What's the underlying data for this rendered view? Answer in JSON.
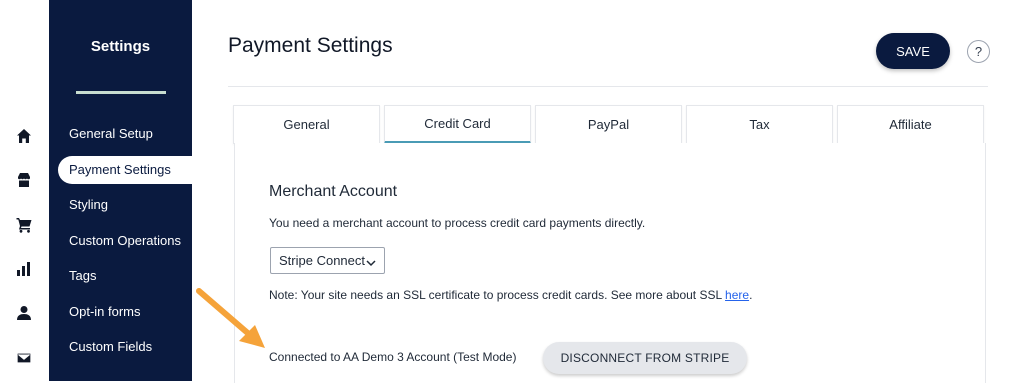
{
  "rail": {
    "icons": [
      "home-icon",
      "store-icon",
      "cart-icon",
      "chart-icon",
      "user-icon",
      "mail-icon"
    ]
  },
  "sidebar": {
    "title": "Settings",
    "items": [
      {
        "label": "General Setup",
        "active": false
      },
      {
        "label": "Payment Settings",
        "active": true
      },
      {
        "label": "Styling",
        "active": false
      },
      {
        "label": "Custom Operations",
        "active": false
      },
      {
        "label": "Tags",
        "active": false
      },
      {
        "label": "Opt-in forms",
        "active": false
      },
      {
        "label": "Custom Fields",
        "active": false
      }
    ]
  },
  "header": {
    "title": "Payment Settings",
    "save_label": "SAVE",
    "help_label": "?"
  },
  "tabs": [
    {
      "label": "General",
      "active": false
    },
    {
      "label": "Credit Card",
      "active": true
    },
    {
      "label": "PayPal",
      "active": false
    },
    {
      "label": "Tax",
      "active": false
    },
    {
      "label": "Affiliate",
      "active": false
    }
  ],
  "merchant": {
    "title": "Merchant Account",
    "description": "You need a merchant account to process credit card payments directly.",
    "select_value": "Stripe Connect",
    "note_prefix": "Note: Your site needs an SSL certificate to process credit cards. See more about SSL ",
    "note_link": "here",
    "note_suffix": ".",
    "connected_text": "Connected to AA Demo 3 Account (Test Mode)",
    "disconnect_label": "DISCONNECT FROM STRIPE"
  },
  "colors": {
    "sidebar_bg": "#0a1a3f",
    "accent_tab": "#4a9bb5",
    "annotation_arrow": "#f5a33a"
  }
}
